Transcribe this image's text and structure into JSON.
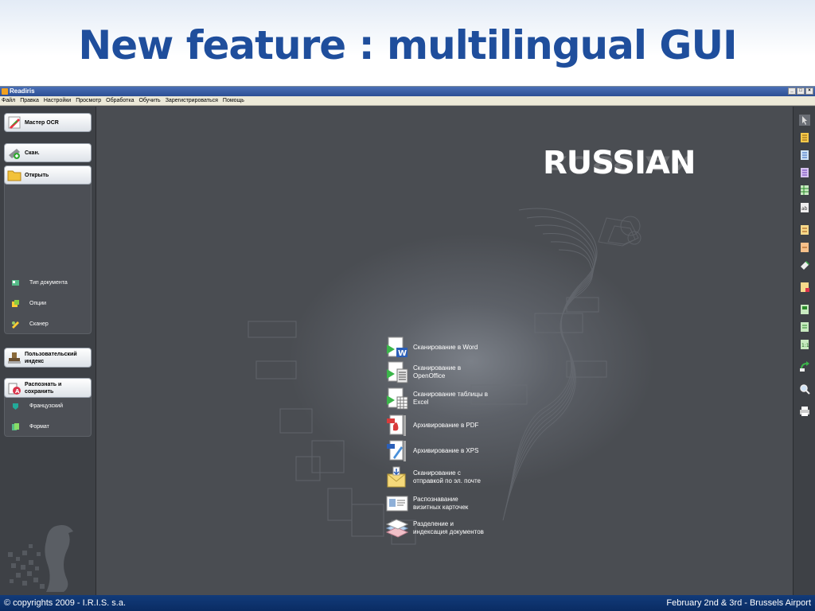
{
  "slide": {
    "title": "New feature : multilingual GUI",
    "footer_left": "© copyrights 2009 - I.R.I.S. s.a.",
    "footer_right": "February 2nd & 3rd - Brussels Airport"
  },
  "window": {
    "title": "Readiris"
  },
  "menu": [
    "Файл",
    "Правка",
    "Настройки",
    "Просмотр",
    "Обработка",
    "Обучить",
    "Зарегистрироваться",
    "Помощь"
  ],
  "sidebar": {
    "wizard": "Мастер OCR",
    "scan": "Скан.",
    "open": "Открыть",
    "doc_type": "Тип документа",
    "options": "Опции",
    "scanner": "Сканер",
    "user_index_line1": "Пользовательский",
    "user_index_line2": "индекс",
    "recognize_line1": "Распознать и",
    "recognize_line2": "сохранить",
    "language": "Французский",
    "format": "Формат"
  },
  "workspace": {
    "language_label": "RUSSIAN",
    "actions": [
      {
        "line1": "Сканирование в Word",
        "line2": ""
      },
      {
        "line1": "Сканирование в",
        "line2": "OpenOffice"
      },
      {
        "line1": "Сканирование таблицы в",
        "line2": "Excel"
      },
      {
        "line1": "Архивирование в PDF",
        "line2": ""
      },
      {
        "line1": "Архивирование в XPS",
        "line2": ""
      },
      {
        "line1": "Сканирование с",
        "line2": "отправкой по эл. почте"
      },
      {
        "line1": "Распознавание",
        "line2": "визитных карточек"
      },
      {
        "line1": "Разделение и",
        "line2": "индексация документов"
      }
    ]
  },
  "colors": {
    "title": "#1f4e9c",
    "workspace_bg": "#4a4d52",
    "footer_bg": "#0a2c63"
  }
}
